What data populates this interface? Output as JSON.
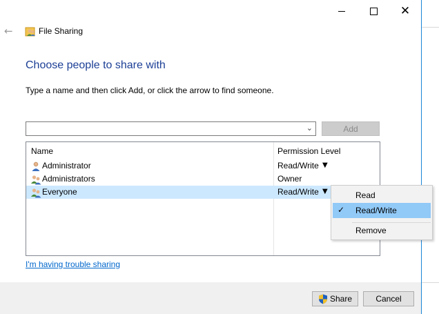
{
  "window": {
    "title": "File Sharing",
    "accent": "#1883d7"
  },
  "caption_buttons": {
    "minimize": "minimize-icon",
    "maximize": "maximize-icon",
    "close": "close-icon",
    "close_glyph": "✕"
  },
  "nav": {
    "back_icon": "back-arrow-icon",
    "back_glyph": "←"
  },
  "main": {
    "heading": "Choose people to share with",
    "instruction": "Type a name and then click Add, or click the arrow to find someone.",
    "heading_color": "#1c3f95"
  },
  "name_input": {
    "value": "",
    "placeholder": ""
  },
  "add_button": {
    "label": "Add",
    "enabled": false
  },
  "list": {
    "columns": {
      "name": "Name",
      "permission": "Permission Level"
    },
    "rows": [
      {
        "name": "Administrator",
        "permission": "Read/Write",
        "has_dropdown": true,
        "icon": "user-icon",
        "selected": false
      },
      {
        "name": "Administrators",
        "permission": "Owner",
        "has_dropdown": false,
        "icon": "group-icon",
        "selected": false
      },
      {
        "name": "Everyone",
        "permission": "Read/Write",
        "has_dropdown": true,
        "icon": "group-icon",
        "selected": true
      }
    ],
    "caret_glyph": "▼"
  },
  "context_menu": {
    "items": [
      {
        "label": "Read",
        "checked": false,
        "highlighted": false
      },
      {
        "label": "Read/Write",
        "checked": true,
        "highlighted": true
      },
      {
        "label": "Remove",
        "checked": false,
        "highlighted": false
      }
    ],
    "check_glyph": "✓"
  },
  "trouble_link": "I'm having trouble sharing",
  "footer": {
    "share_label": "Share",
    "cancel_label": "Cancel"
  }
}
